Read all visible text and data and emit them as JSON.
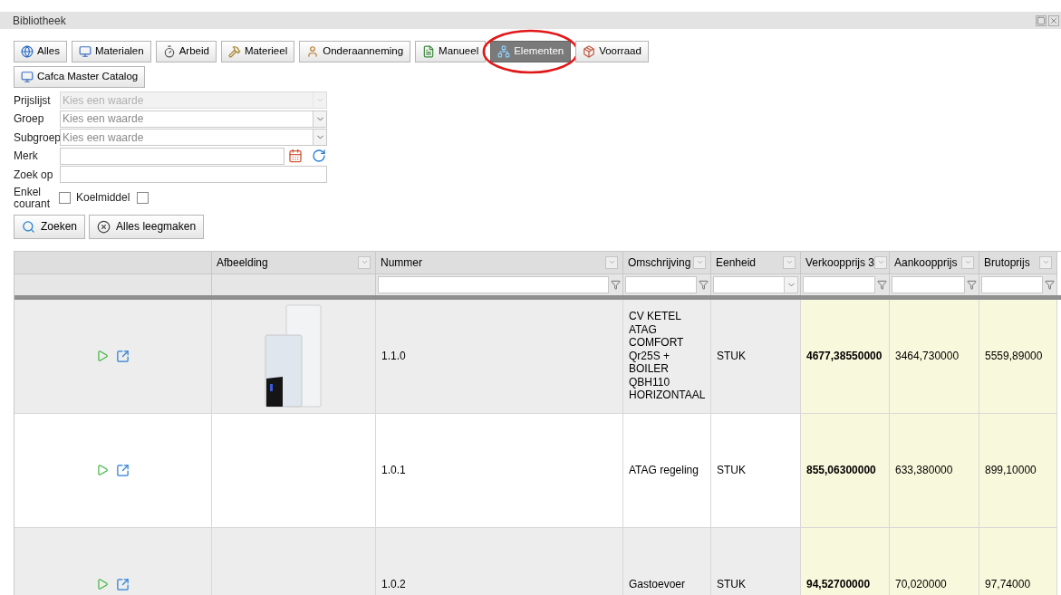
{
  "window": {
    "title": "Bibliotheek"
  },
  "categories": [
    {
      "label": "Alles",
      "selected": false,
      "circled": false
    },
    {
      "label": "Materialen",
      "selected": false,
      "circled": false
    },
    {
      "label": "Arbeid",
      "selected": false,
      "circled": false
    },
    {
      "label": "Materieel",
      "selected": false,
      "circled": false
    },
    {
      "label": "Onderaanneming",
      "selected": false,
      "circled": false
    },
    {
      "label": "Manueel",
      "selected": false,
      "circled": false
    },
    {
      "label": "Elementen",
      "selected": true,
      "circled": true
    },
    {
      "label": "Voorraad",
      "selected": false,
      "circled": false
    },
    {
      "label": "Cafca Master Catalog",
      "selected": false,
      "circled": false
    }
  ],
  "filters": [
    {
      "label": "Prijslijst",
      "kind": "select",
      "placeholder": "Kies een waarde",
      "disabled": true
    },
    {
      "label": "Groep",
      "kind": "select",
      "placeholder": "Kies een waarde",
      "disabled": false
    },
    {
      "label": "Subgroep",
      "kind": "select",
      "placeholder": "Kies een waarde",
      "disabled": false
    },
    {
      "label": "Merk",
      "kind": "picker",
      "disabled": false
    },
    {
      "label": "Zoek op",
      "kind": "text",
      "disabled": false
    }
  ],
  "checkboxes": [
    {
      "label": "Enkel courant",
      "checked": false
    },
    {
      "label": "Koelmiddel",
      "checked": false
    }
  ],
  "actions": [
    {
      "label": "Zoeken"
    },
    {
      "label": "Alles leegmaken"
    }
  ],
  "table": {
    "columns": [
      {
        "kind": "none",
        "highlighted": false
      },
      {
        "label": "Afbeelding",
        "kind": "none",
        "highlighted": false
      },
      {
        "label": "Nummer",
        "kind": "text",
        "highlighted": false,
        "bold": false
      },
      {
        "label": "Omschrijving",
        "kind": "text",
        "highlighted": false,
        "bold": false
      },
      {
        "label": "Eenheid",
        "kind": "select",
        "highlighted": false,
        "bold": false
      },
      {
        "label": "Verkoopprijs 3",
        "kind": "text",
        "highlighted": true,
        "bold": true
      },
      {
        "label": "Aankoopprijs",
        "kind": "text",
        "highlighted": true,
        "bold": false
      },
      {
        "label": "Brutoprijs",
        "kind": "text",
        "highlighted": true,
        "bold": false
      }
    ],
    "rows": [
      {
        "image": true,
        "cells": [
          "",
          "",
          "1.1.0",
          "CV KETEL ATAG COMFORT Qr25S + BOILER QBH110 HORIZONTAAL",
          "STUK",
          "4677,38550000",
          "3464,730000",
          "5559,89000"
        ]
      },
      {
        "image": false,
        "cells": [
          "",
          "",
          "1.0.1",
          "ATAG regeling",
          "STUK",
          "855,06300000",
          "633,380000",
          "899,10000"
        ]
      },
      {
        "image": false,
        "cells": [
          "",
          "",
          "1.0.2",
          "Gastoevoer",
          "STUK",
          "94,52700000",
          "70,020000",
          "97,74000"
        ]
      }
    ]
  }
}
